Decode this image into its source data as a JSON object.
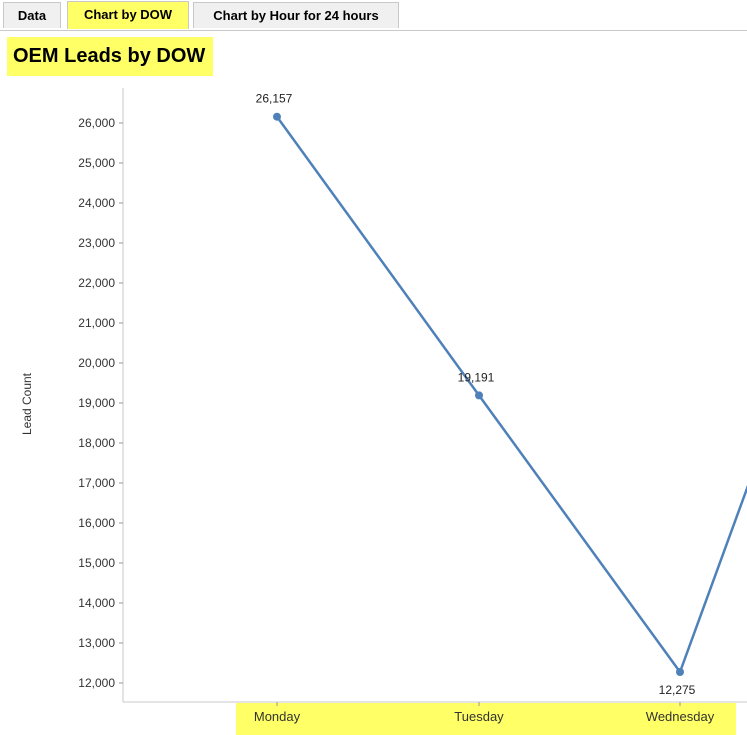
{
  "tabs": [
    {
      "label": "Data",
      "active": false
    },
    {
      "label": "Chart by DOW",
      "active": true
    },
    {
      "label": "Chart by Hour for 24 hours",
      "active": false
    }
  ],
  "colors": {
    "highlight": "#ffff66",
    "line": "#4e81b9"
  },
  "chart_data": {
    "type": "line",
    "title": "OEM Leads by DOW",
    "ylabel": "Lead Count",
    "xlabel": "",
    "categories": [
      "Monday",
      "Tuesday",
      "Wednesday"
    ],
    "series": [
      {
        "values": [
          26157,
          19191,
          12275
        ]
      }
    ],
    "data_labels": [
      "26,157",
      "19,191",
      "12,275"
    ],
    "next_point_value": 17000,
    "yticks": [
      12000,
      13000,
      14000,
      15000,
      16000,
      17000,
      18000,
      19000,
      20000,
      21000,
      22000,
      23000,
      24000,
      25000,
      26000
    ],
    "ytick_labels": [
      "12,000",
      "13,000",
      "14,000",
      "15,000",
      "16,000",
      "17,000",
      "18,000",
      "19,000",
      "20,000",
      "21,000",
      "22,000",
      "23,000",
      "24,000",
      "25,000",
      "26,000"
    ],
    "grid": false,
    "legend": "none"
  }
}
